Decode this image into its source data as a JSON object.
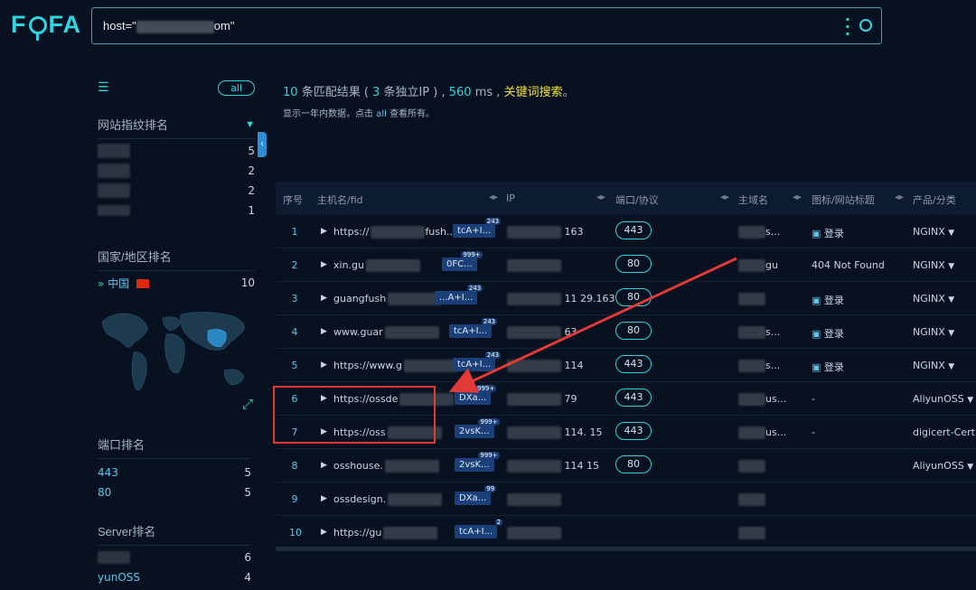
{
  "logo": {
    "text_f": "F",
    "text_fa": "FA"
  },
  "search": {
    "query_prefix": "host=\"",
    "query_suffix": "om\""
  },
  "sidebar": {
    "filter_all": "all",
    "fingerprint": {
      "title": "网站指纹排名",
      "counts": [
        "5",
        "2",
        "2",
        "1"
      ]
    },
    "country": {
      "title": "国家/地区排名",
      "name": "中国",
      "count": "10"
    },
    "port_rank": {
      "title": "端口排名",
      "items": [
        {
          "label": "443",
          "count": "5"
        },
        {
          "label": "80",
          "count": "5"
        }
      ]
    },
    "server_rank": {
      "title": "Server排名",
      "items": [
        {
          "label": "",
          "count": "6"
        },
        {
          "label": "yunOSS",
          "count": "4"
        }
      ]
    }
  },
  "summary": {
    "count": "10",
    "count_text": "条匹配结果 (",
    "ips": "3",
    "ips_text": "条独立IP ) ,",
    "ms": "560",
    "ms_text": "ms ,",
    "keyword": "关键词搜索",
    "period": "。",
    "note_pre": "显示一年内数据，点击",
    "note_link": "all",
    "note_post": "查看所有。"
  },
  "table": {
    "headers": {
      "idx": "序号",
      "host": "主机名/fid",
      "ip": "IP",
      "port": "端口/协议",
      "domain": "主域名",
      "title": "图标/网站标题",
      "product": "产品/分类"
    },
    "rows": [
      {
        "idx": "1",
        "host": "https://",
        "host2": "fush...",
        "badge": "tcA+I...",
        "badge_sup": "243",
        "ip_tail": "163",
        "port": "443",
        "dom": "s...",
        "title": "登录",
        "title_icon": true,
        "product": "NGINX"
      },
      {
        "idx": "2",
        "host": "xin.gu",
        "host2": "",
        "badge": "0FC...",
        "badge_sup": "999+",
        "ip_tail": "",
        "port": "80",
        "dom": "gu",
        "title": "404 Not Found",
        "title_icon": false,
        "product": "NGINX"
      },
      {
        "idx": "3",
        "host": "guangfush",
        "host2": "",
        "badge": "...A+I...",
        "badge_sup": "243",
        "ip_tail": "11        29.163",
        "port": "80",
        "dom": "",
        "title": "登录",
        "title_icon": true,
        "product": "NGINX"
      },
      {
        "idx": "4",
        "host": "www.guar",
        "host2": "",
        "badge": "tcA+I...",
        "badge_sup": "243",
        "ip_tail": "63",
        "port": "80",
        "dom": "s...",
        "title": "登录",
        "title_icon": true,
        "product": "NGINX"
      },
      {
        "idx": "5",
        "host": "https://www.g",
        "host2": "",
        "badge": "tcA+I...",
        "badge_sup": "243",
        "ip_tail": "114",
        "port": "443",
        "dom": "s...",
        "title": "登录",
        "title_icon": true,
        "product": "NGINX"
      },
      {
        "idx": "6",
        "host": "https://ossde",
        "host2": "",
        "badge": "DXa...",
        "badge_sup": "999+",
        "ip_tail": "79",
        "port": "443",
        "dom": "us...",
        "title": "-",
        "title_icon": false,
        "product": "AliyunOSS"
      },
      {
        "idx": "7",
        "host": "https://oss",
        "host2": "",
        "badge": "2vsK...",
        "badge_sup": "999+",
        "ip_tail": "114.       15",
        "port": "443",
        "dom": "us...",
        "title": "-",
        "title_icon": false,
        "product": "digicert-Cert"
      },
      {
        "idx": "8",
        "host": "osshouse.",
        "host2": "",
        "badge": "2vsK...",
        "badge_sup": "999+",
        "ip_tail": "114       15",
        "port": "80",
        "dom": "",
        "title": "",
        "title_icon": false,
        "product": "AliyunOSS"
      },
      {
        "idx": "9",
        "host": "ossdesign.",
        "host2": "",
        "badge": "DXa...",
        "badge_sup": "99",
        "ip_tail": "",
        "port": "",
        "dom": "",
        "title": "",
        "title_icon": false,
        "product": ""
      },
      {
        "idx": "10",
        "host": "https://gu",
        "host2": "",
        "badge": "tcA+I...",
        "badge_sup": "2",
        "ip_tail": "",
        "port": "",
        "dom": "",
        "title": "",
        "title_icon": false,
        "product": ""
      }
    ]
  },
  "colors": {
    "accent": "#2fd5e0",
    "keyword": "#f5e23a",
    "annotation": "#e23a36"
  },
  "icons": [
    "filter-icon",
    "funnel-icon",
    "more-icon",
    "search-icon",
    "collapse-icon",
    "expand-icon",
    "double-chevron-icon",
    "china-flag-icon",
    "caret-right-icon",
    "dropdown-icon",
    "image-icon"
  ]
}
